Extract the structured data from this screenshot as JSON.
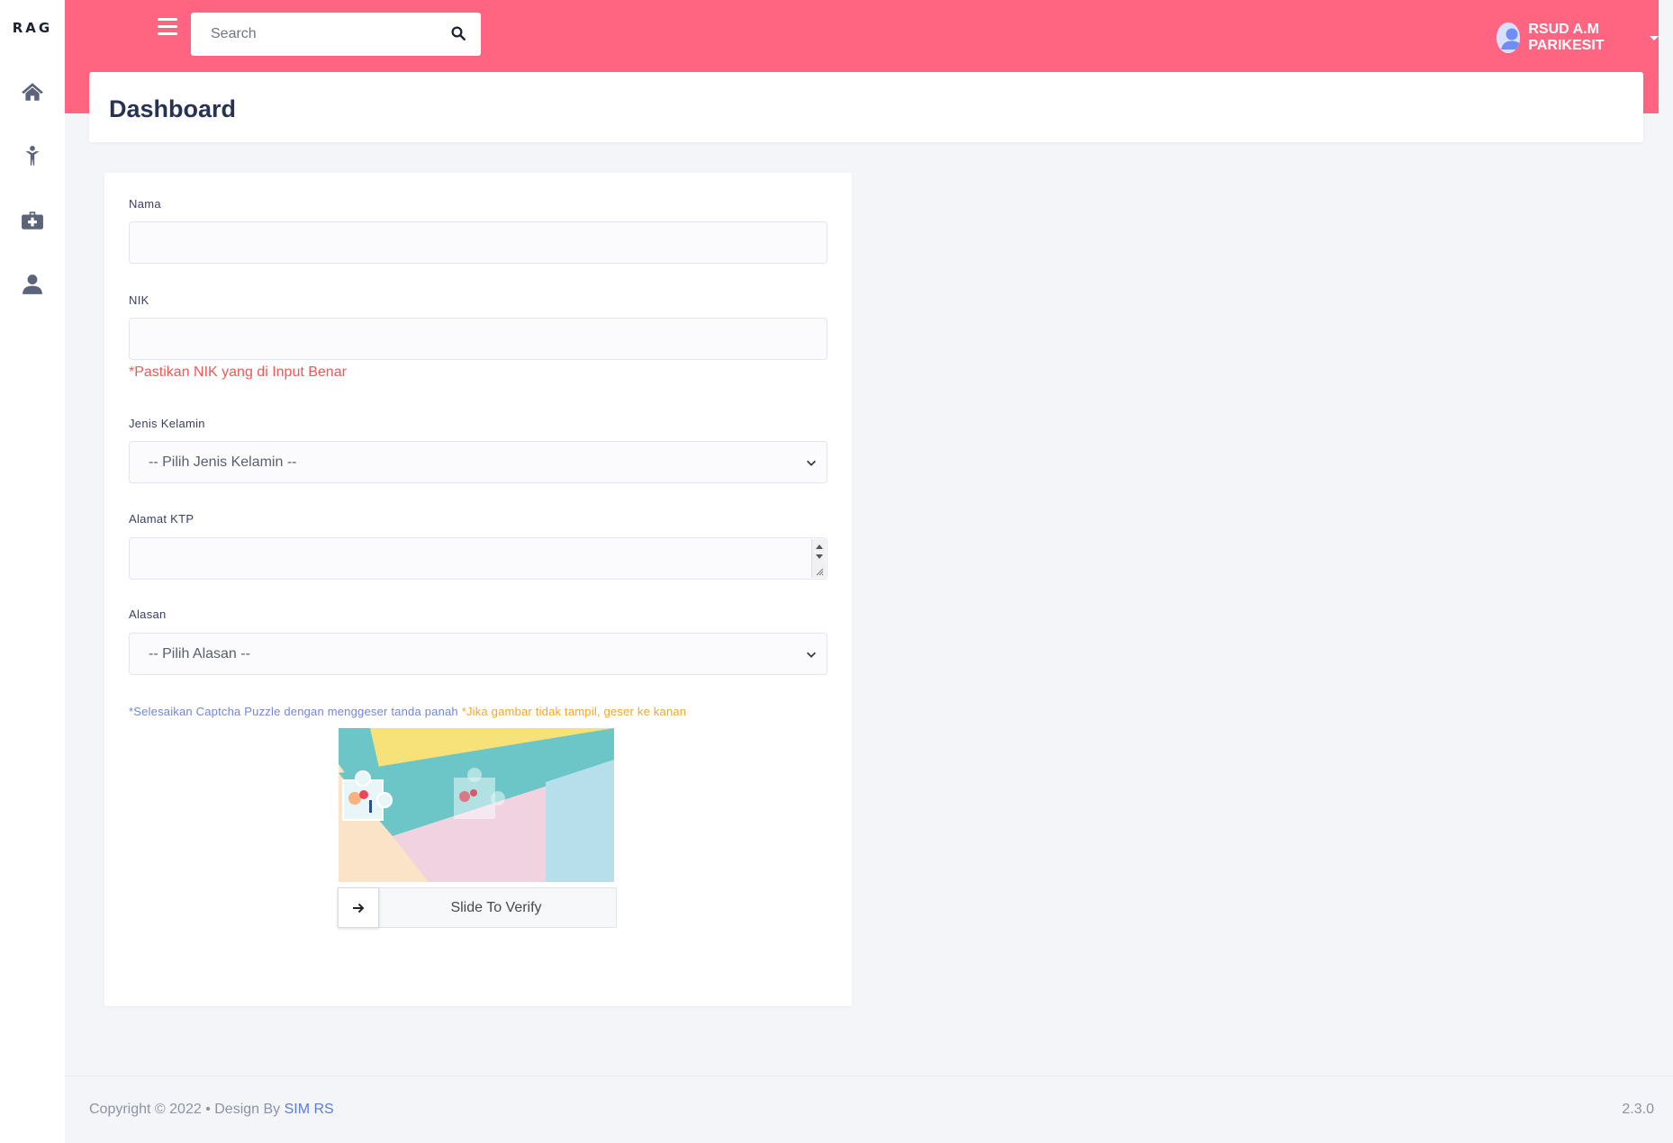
{
  "sidebar": {
    "brand": "RAG",
    "items": [
      {
        "icon": "home-icon"
      },
      {
        "icon": "person-icon"
      },
      {
        "icon": "medical-kit-icon"
      },
      {
        "icon": "user-icon"
      }
    ]
  },
  "header": {
    "search_placeholder": "Search",
    "user_name": "RSUD A.M PARIKESIT",
    "accent_color": "#ff6481"
  },
  "page": {
    "title": "Dashboard"
  },
  "form": {
    "nama_label": "Nama",
    "nama_value": "",
    "nik_label": "NIK",
    "nik_value": "",
    "nik_help": "*Pastikan NIK yang di Input Benar",
    "gender_label": "Jenis Kelamin",
    "gender_selected": "-- Pilih Jenis Kelamin --",
    "alamat_label": "Alamat KTP",
    "alamat_value": "",
    "alasan_label": "Alasan",
    "alasan_selected": "-- Pilih Alasan --",
    "captcha_note": "*Selesaikan Captcha Puzzle dengan menggeser tanda panah ",
    "captcha_note_warning": "*Jika gambar tidak tampil, geser ke kanan",
    "slider_label": "Slide To Verify"
  },
  "footer": {
    "copyright": "Copyright © 2022  •  Design By ",
    "link": "SIM RS",
    "version": "2.3.0"
  }
}
